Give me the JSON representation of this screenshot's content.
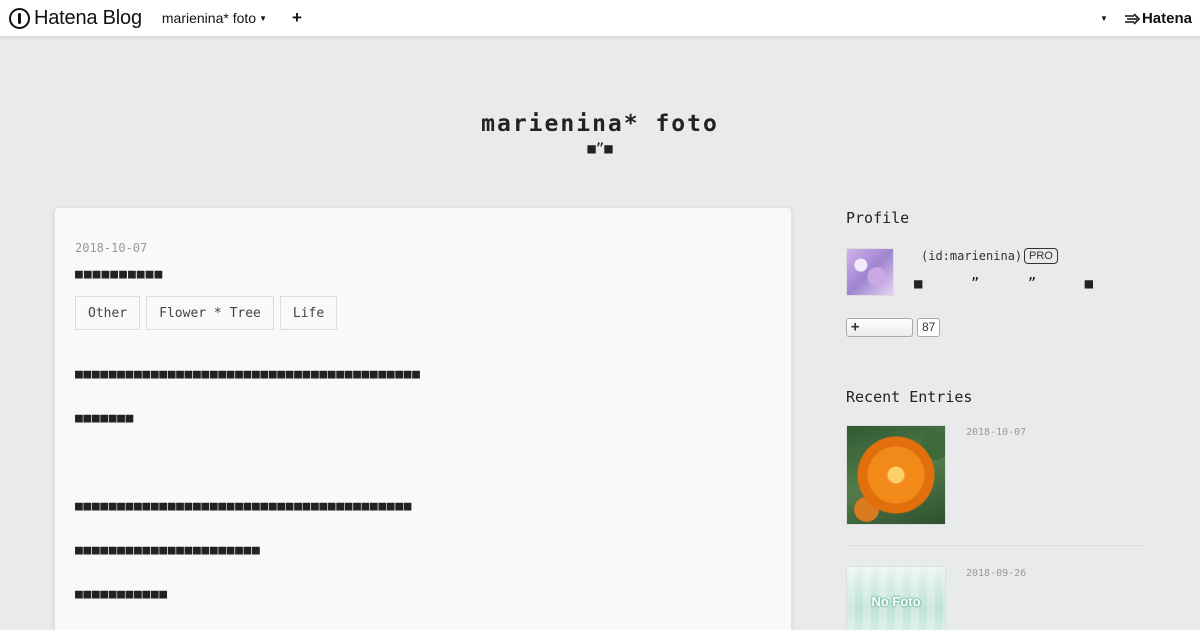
{
  "topbar": {
    "brand": "Hatena Blog",
    "blog_switch": "marienina* foto",
    "add_label": "+",
    "hatena": "Hatena"
  },
  "blog": {
    "title": "marienina* foto",
    "description": "■ˮ■"
  },
  "entry": {
    "date": "2018-10-07",
    "title": "■■■■■■■■■■",
    "categories": [
      "Other",
      "Flower * Tree",
      "Life"
    ],
    "paragraphs": [
      "■■■■■■■■■■■■■■■■■■■■■■■■■■■■■■■■■■■■■■■■■",
      "■■■■■■■",
      "■■■■■■■■■■■■■■■■■■■■■■■■■■■■■■■■■■■■■■■■",
      "■■■■■■■■■■■■■■■■■■■■■■",
      "■■■■■■■■■■■"
    ]
  },
  "sidebar": {
    "profile": {
      "heading": "Profile",
      "id": "(id:marienina)",
      "badge": "PRO",
      "description": "■ ” ” ■",
      "follow_label": "+",
      "follow_count": "87"
    },
    "recent": {
      "heading": "Recent Entries",
      "items": [
        {
          "date": "2018-10-07"
        },
        {
          "date": "2018-09-26",
          "thumb_text": "No Foto"
        }
      ]
    }
  }
}
